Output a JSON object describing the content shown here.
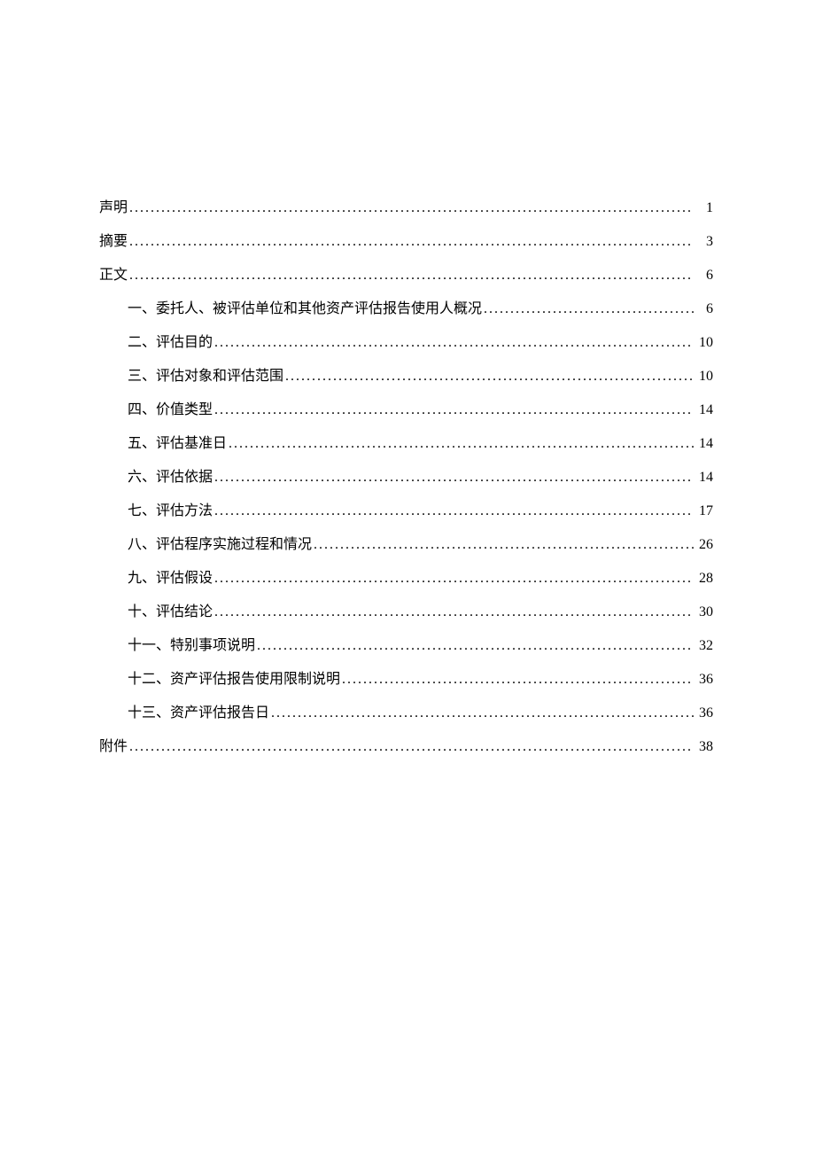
{
  "toc": [
    {
      "label": "声明",
      "page": 1,
      "indent": 0
    },
    {
      "label": "摘要",
      "page": 3,
      "indent": 0
    },
    {
      "label": "正文",
      "page": 6,
      "indent": 0
    },
    {
      "label": "一、委托人、被评估单位和其他资产评估报告使用人概况",
      "page": 6,
      "indent": 1
    },
    {
      "label": "二、评估目的",
      "page": 10,
      "indent": 1
    },
    {
      "label": "三、评估对象和评估范围",
      "page": 10,
      "indent": 1
    },
    {
      "label": "四、价值类型",
      "page": 14,
      "indent": 1
    },
    {
      "label": "五、评估基准日",
      "page": 14,
      "indent": 1
    },
    {
      "label": "六、评估依据",
      "page": 14,
      "indent": 1
    },
    {
      "label": "七、评估方法",
      "page": 17,
      "indent": 1
    },
    {
      "label": "八、评估程序实施过程和情况",
      "page": 26,
      "indent": 1
    },
    {
      "label": "九、评估假设",
      "page": 28,
      "indent": 1
    },
    {
      "label": "十、评估结论",
      "page": 30,
      "indent": 1
    },
    {
      "label": "十一、特别事项说明",
      "page": 32,
      "indent": 1
    },
    {
      "label": "十二、资产评估报告使用限制说明",
      "page": 36,
      "indent": 1
    },
    {
      "label": "十三、资产评估报告日",
      "page": 36,
      "indent": 1
    },
    {
      "label": "附件",
      "page": 38,
      "indent": 0
    }
  ]
}
